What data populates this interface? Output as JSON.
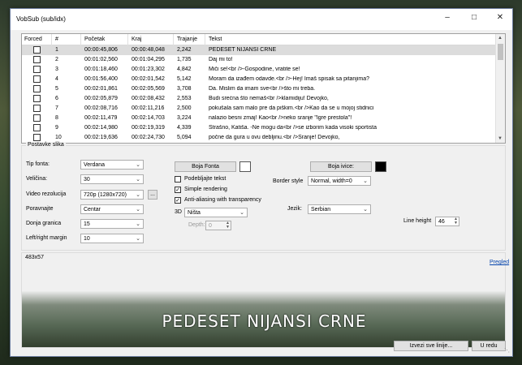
{
  "window": {
    "title": "VobSub (sub/idx)"
  },
  "grid": {
    "headers": [
      "Forced",
      "#",
      "Početak",
      "Kraj",
      "Trajanje",
      "Tekst"
    ],
    "rows": [
      {
        "n": "1",
        "start": "00:00:45,806",
        "end": "00:00:48,048",
        "dur": "2,242",
        "text": "PEDESET NIJANSI CRNE"
      },
      {
        "n": "2",
        "start": "00:01:02,560",
        "end": "00:01:04,295",
        "dur": "1,735",
        "text": "Daj mi to!"
      },
      {
        "n": "3",
        "start": "00:01:18,460",
        "end": "00:01:23,302",
        "dur": "4,842",
        "text": "Miči se!<br />-Gospodine, vratite se!"
      },
      {
        "n": "4",
        "start": "00:01:56,400",
        "end": "00:02:01,542",
        "dur": "5,142",
        "text": "Moram da izađem odavde.<br />-Hej! Imaš spisak sa pitanjima?"
      },
      {
        "n": "5",
        "start": "00:02:01,861",
        "end": "00:02:05,569",
        "dur": "3,708",
        "text": "Da. Mislim da imam sve<br />što mi treba."
      },
      {
        "n": "6",
        "start": "00:02:05,879",
        "end": "00:02:08,432",
        "dur": "2,553",
        "text": "Budi srećna što nemaš<br />klamidiju! Devojko,"
      },
      {
        "n": "7",
        "start": "00:02:08,716",
        "end": "00:02:11,216",
        "dur": "2,500",
        "text": "pokušala sam malo pre da piškim.<br />Kao da se u mojoj stidnici"
      },
      {
        "n": "8",
        "start": "00:02:11,479",
        "end": "00:02:14,703",
        "dur": "3,224",
        "text": "nalazio besni zmaj! Kao<br />neko sranje \"Igre prestola\"!"
      },
      {
        "n": "9",
        "start": "00:02:14,980",
        "end": "00:02:19,319",
        "dur": "4,339",
        "text": "Strašno, Katiša. -Ne mogu da<br />se izborim kada visoki sportista"
      },
      {
        "n": "10",
        "start": "00:02:19,636",
        "end": "00:02:24,730",
        "dur": "5,094",
        "text": "počne da gura u ovu debljinu.<br />Sranje! Devojko,"
      }
    ]
  },
  "settings": {
    "group_label": "Postavke slika",
    "font_label": "Tip fonta:",
    "font_value": "Verdana",
    "size_label": "Veličina:",
    "size_value": "30",
    "res_label": "Video rezolucija",
    "res_value": "720p (1280x720)",
    "res_btn": "...",
    "align_label": "Poravnajte",
    "align_value": "Centar",
    "bottom_label": "Donja granica",
    "bottom_value": "15",
    "lr_label": "Left/right margin",
    "lr_value": "10",
    "font_color_btn": "Boja Fonta",
    "font_color": "#ffffff",
    "underline_label": "Podebljajte tekst",
    "simple_label": "Simple rendering",
    "aa_label": "Anti-aliasing with transparency",
    "three_d_label": "3D",
    "three_d_value": "Ništa",
    "depth_label": "Depth:",
    "depth_value": "0",
    "border_color_btn": "Boja ivice:",
    "border_color": "#000000",
    "border_style_label": "Border style",
    "border_style_value": "Normal, width=0",
    "lang_label": "Jezik:",
    "lang_value": "Serbian",
    "line_height_label": "Line height",
    "line_height_value": "46"
  },
  "preview": {
    "size_label": "483x57",
    "link": "Pregled",
    "subtitle": "PEDESET NIJANSI CRNE"
  },
  "footer": {
    "export_btn": "Izvezi sve linije...",
    "ok_btn": "U redu"
  }
}
